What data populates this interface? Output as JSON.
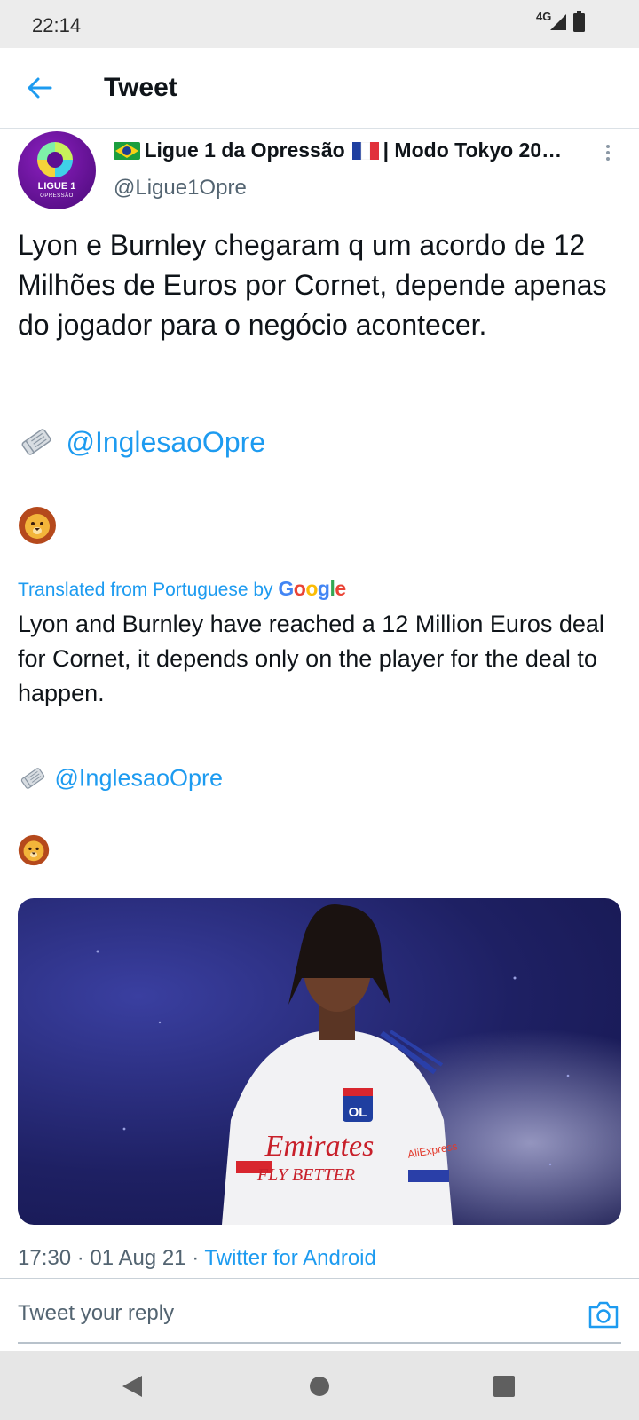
{
  "status_bar": {
    "time": "22:14",
    "network": "4G"
  },
  "header": {
    "title": "Tweet"
  },
  "tweet": {
    "author_name": "Ligue 1 da Opressão",
    "author_name_suffix": "| Modo Tokyo 20…",
    "handle": "@Ligue1Opre",
    "avatar_text_line1": "LIGUE 1",
    "avatar_text_line2": "OPRESSÃO",
    "body": "Lyon e Burnley chegaram q um acordo de 12 Milhões de Euros por Cornet, depende apenas do jogador para o negócio acontecer.",
    "mention": "@InglesaoOpre",
    "translated_label": "Translated from Portuguese by",
    "translated_provider": "Google",
    "translation": "Lyon and Burnley have reached a 12 Million Euros deal for Cornet, it depends only on the player for the deal to happen.",
    "translation_mention": "@InglesaoOpre",
    "image_text": {
      "sponsor": "Emirates",
      "slogan": "FLY BETTER",
      "side": "AliExpress",
      "crest": "OL"
    },
    "time": "17:30",
    "date": "01 Aug 21",
    "source": "Twitter for Android",
    "separator": "·"
  },
  "reply": {
    "placeholder": "Tweet your reply"
  },
  "icons": {
    "back": "arrow-left-icon",
    "more": "kebab-icon",
    "camera": "camera-icon",
    "newspaper": "rolled-newspaper-emoji",
    "lion": "lion-face-emoji"
  },
  "colors": {
    "accent": "#1d9bf0",
    "text": "#0f1419",
    "secondary": "#536471"
  }
}
